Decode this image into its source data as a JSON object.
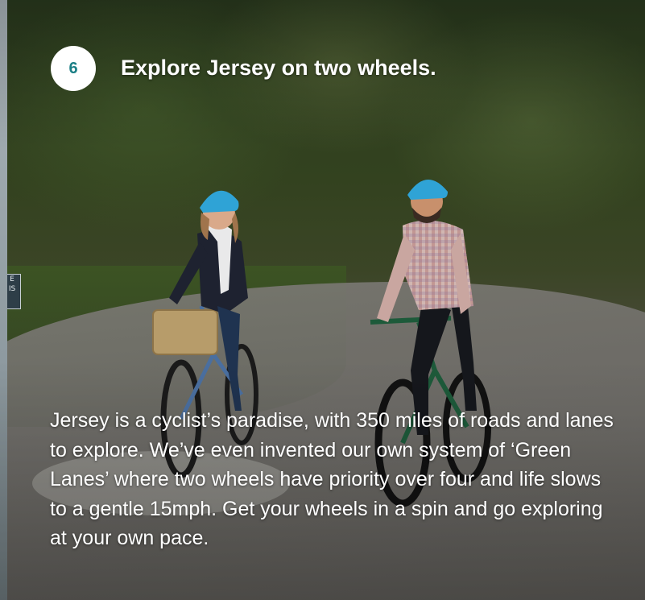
{
  "badge": {
    "number": "6"
  },
  "heading": {
    "text": "Explore Jersey on two wheels."
  },
  "body": {
    "text": "Jersey is a cyclist’s paradise, with 350 miles of roads and lanes to explore. We’ve even invented our own system of ‘Green Lanes’ where two wheels have priority over four and life slows to a gentle 15mph. Get your wheels in a spin and go exploring at your own pace."
  },
  "colors": {
    "badge_background": "#ffffff",
    "badge_number": "#1b7f86",
    "text": "#ffffff",
    "helmet": "#2fa3d6"
  }
}
